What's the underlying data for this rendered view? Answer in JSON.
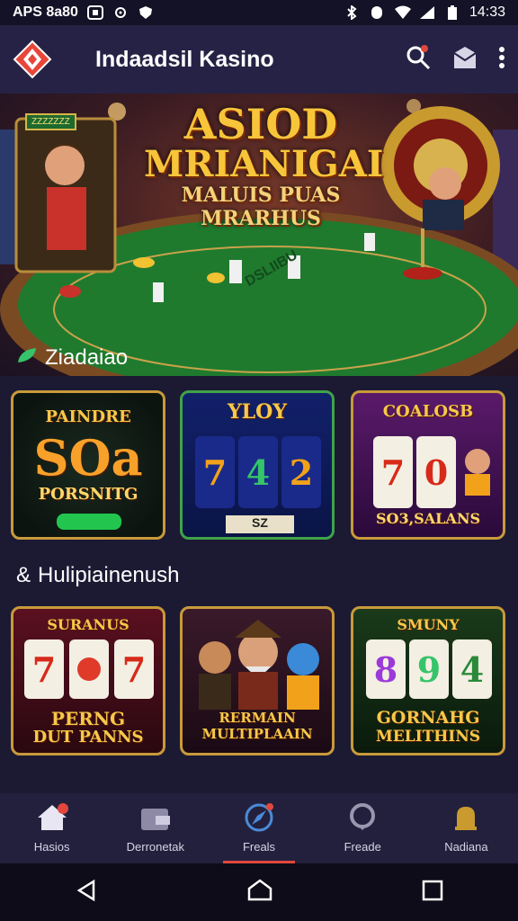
{
  "status_bar": {
    "left_text": "APS 8a80",
    "time": "14:33"
  },
  "app_bar": {
    "title": "Indaadsil Kasino",
    "icons": [
      "logo-diamond-icon",
      "search-icon",
      "gift-box-icon",
      "more-vert-icon"
    ]
  },
  "banner": {
    "badge": "ZZZZZZZ",
    "title_line1": "ASIOD",
    "title_line2": "MRIANIGAI",
    "title_line3": "MALUIS PUAS MRARHUS",
    "table_text": "DSLIIBU"
  },
  "section1": {
    "label": "Ziadaiao",
    "games": [
      {
        "top": "PAINDRE",
        "big": "SOa",
        "sub": "PORSNITG"
      },
      {
        "top": "YLOY",
        "reels": [
          "7",
          "4",
          "2"
        ],
        "sub": "SZ"
      },
      {
        "top": "COALOSB",
        "reels": [
          "7",
          "0"
        ],
        "sub": "SO3,SALANS"
      }
    ]
  },
  "section2": {
    "label": "Hulipiainenush",
    "games": [
      {
        "top": "SURANUS",
        "reels": [
          "7",
          "",
          "7"
        ],
        "sub1": "PERNG",
        "sub2": "DUT PANNS"
      },
      {
        "top": "",
        "sub1": "RERMAIN",
        "sub2": "MULTIPLAAIN"
      },
      {
        "top": "SMUNY",
        "reels": [
          "8",
          "9",
          "4"
        ],
        "sub1": "GORNAHG",
        "sub2": "MELITHINS"
      }
    ]
  },
  "bottom_nav": [
    {
      "label": "Hasios",
      "icon": "home-icon"
    },
    {
      "label": "Derronetak",
      "icon": "wallet-icon"
    },
    {
      "label": "Freals",
      "icon": "compass-icon"
    },
    {
      "label": "Freade",
      "icon": "chat-icon"
    },
    {
      "label": "Nadiana",
      "icon": "bell-icon"
    }
  ],
  "colors": {
    "accent": "#e2473c",
    "gold": "#f6c84a",
    "background": "#1c1a33"
  }
}
